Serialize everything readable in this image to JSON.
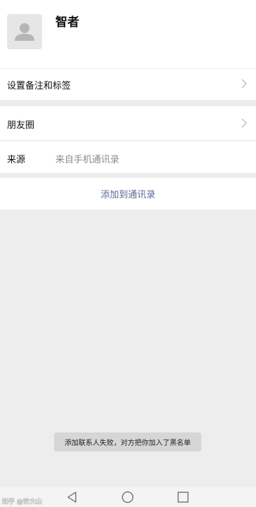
{
  "profile": {
    "name": "智者",
    "avatar_icon": "default-avatar-icon"
  },
  "rows": {
    "remark": {
      "label": "设置备注和标签",
      "icon": "chevron-right-icon"
    },
    "moments": {
      "label": "朋友圈",
      "icon": "chevron-right-icon"
    },
    "source": {
      "label": "来源",
      "value": "来自手机通讯录"
    }
  },
  "actions": {
    "add_to_contacts": "添加到通讯录"
  },
  "toast": {
    "message": "添加联系人失败，对方把你加入了黑名单"
  },
  "navbar": {
    "back_icon": "back-triangle-icon",
    "home_icon": "home-circle-icon",
    "recent_icon": "recent-square-icon"
  },
  "watermark": {
    "text": "知乎 @安大山"
  },
  "colors": {
    "link": "#576b95",
    "background": "#ededed",
    "toast_bg": "#d6d6d6"
  }
}
